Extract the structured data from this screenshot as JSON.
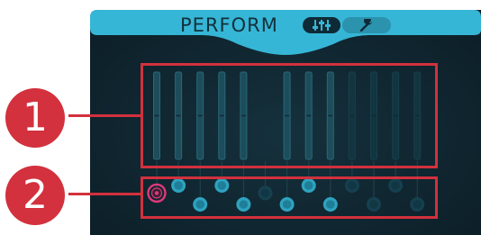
{
  "header": {
    "title": "PERFORM",
    "mixer_button_icon": "mixer-sliders-icon",
    "settings_button_icon": "wrench-icon",
    "accent_color": "#36b6d6"
  },
  "callouts": [
    {
      "label": "1"
    },
    {
      "label": "2"
    }
  ],
  "colors": {
    "callout": "#d2313d",
    "panel": "#102630",
    "knob_active": "#2ea3bf",
    "knob_inactive": "#16404f",
    "knob_selected": "#e0387a"
  },
  "channels": [
    {
      "fader_active": true,
      "knob_level": 0.6,
      "knob_active": false,
      "selected": true
    },
    {
      "fader_active": true,
      "knob_level": 0.8,
      "knob_active": true,
      "selected": false
    },
    {
      "fader_active": true,
      "knob_level": 0.3,
      "knob_active": true,
      "selected": false
    },
    {
      "fader_active": true,
      "knob_level": 0.8,
      "knob_active": true,
      "selected": false
    },
    {
      "fader_active": true,
      "knob_level": 0.3,
      "knob_active": true,
      "selected": false
    },
    {
      "fader_active": false,
      "knob_level": 0.6,
      "knob_active": false,
      "selected": false
    },
    {
      "fader_active": true,
      "knob_level": 0.3,
      "knob_active": true,
      "selected": false
    },
    {
      "fader_active": true,
      "knob_level": 0.8,
      "knob_active": true,
      "selected": false
    },
    {
      "fader_active": true,
      "knob_level": 0.3,
      "knob_active": true,
      "selected": false
    },
    {
      "fader_active": false,
      "knob_level": 0.8,
      "knob_active": false,
      "selected": false
    },
    {
      "fader_active": false,
      "knob_level": 0.3,
      "knob_active": false,
      "selected": false
    },
    {
      "fader_active": false,
      "knob_level": 0.8,
      "knob_active": false,
      "selected": false
    },
    {
      "fader_active": false,
      "knob_level": 0.3,
      "knob_active": false,
      "selected": false
    }
  ]
}
